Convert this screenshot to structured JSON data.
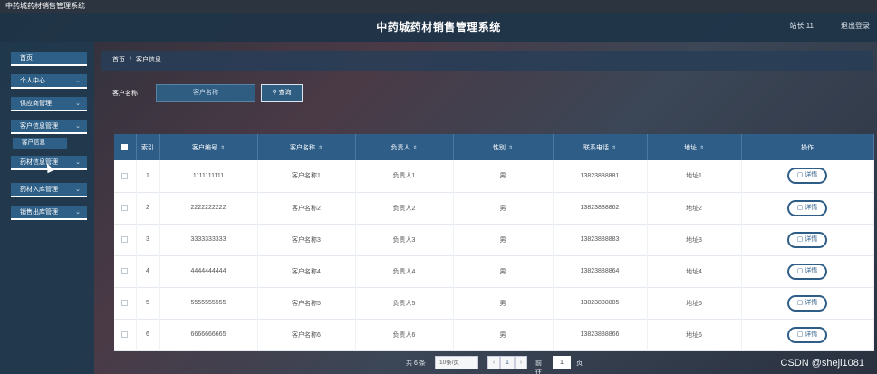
{
  "window": {
    "title": "中药城药材销售管理系统"
  },
  "header": {
    "title": "中药城药材销售管理系统",
    "user": "站长 11",
    "logout": "退出登录"
  },
  "sidebar": {
    "items": [
      {
        "label": "首页",
        "chevron": ""
      },
      {
        "label": "个人中心",
        "chevron": "⌄"
      },
      {
        "label": "供应商管理",
        "chevron": "⌄"
      },
      {
        "label": "客户信息管理",
        "chevron": "⌄"
      },
      {
        "label": "药材信息管理",
        "chevron": "⌄"
      },
      {
        "label": "药材入库管理",
        "chevron": "⌄"
      },
      {
        "label": "销售出库管理",
        "chevron": "⌄"
      }
    ],
    "sub_item": "客户信息"
  },
  "breadcrumb": {
    "home": "首页",
    "sep": "/",
    "current": "客户信息"
  },
  "search": {
    "label": "客户名称",
    "placeholder": "客户名称",
    "button": "查询",
    "button_icon": "search-icon"
  },
  "table": {
    "headers": [
      "索引",
      "客户编号",
      "客户名称",
      "负责人",
      "性别",
      "联系电话",
      "地址",
      "操作"
    ],
    "sort_glyph": "⇕",
    "rows": [
      {
        "idx": "1",
        "code": "1111111111",
        "name": "客户名称1",
        "person": "负责人1",
        "gender": "男",
        "phone": "13823888881",
        "addr": "地址1",
        "action": "详情"
      },
      {
        "idx": "2",
        "code": "2222222222",
        "name": "客户名称2",
        "person": "负责人2",
        "gender": "男",
        "phone": "13823888862",
        "addr": "地址2",
        "action": "详情"
      },
      {
        "idx": "3",
        "code": "3333333333",
        "name": "客户名称3",
        "person": "负责人3",
        "gender": "男",
        "phone": "13823888883",
        "addr": "地址3",
        "action": "详情"
      },
      {
        "idx": "4",
        "code": "4444444444",
        "name": "客户名称4",
        "person": "负责人4",
        "gender": "男",
        "phone": "13823888864",
        "addr": "地址4",
        "action": "详情"
      },
      {
        "idx": "5",
        "code": "5555555555",
        "name": "客户名称5",
        "person": "负责人5",
        "gender": "男",
        "phone": "13823888885",
        "addr": "地址5",
        "action": "详情"
      },
      {
        "idx": "6",
        "code": "6666666665",
        "name": "客户名称6",
        "person": "负责人6",
        "gender": "男",
        "phone": "13823888866",
        "addr": "地址6",
        "action": "详情"
      }
    ]
  },
  "pagination": {
    "total": "共 6 条",
    "page_size": "10条/页",
    "prev": "‹",
    "current": "1",
    "next": "›",
    "goto": "前往",
    "goto_value": "1",
    "unit": "页"
  },
  "watermark": "CSDN @sheji1081",
  "colors": {
    "accent": "#2e5e88",
    "header_bg": "#1e3448",
    "sidebar_item": "#2e5f86"
  }
}
